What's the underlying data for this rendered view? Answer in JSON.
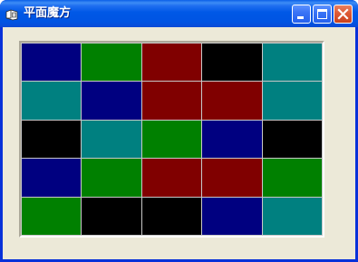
{
  "window": {
    "title": "平面魔方",
    "icon": "app-icon"
  },
  "titlebar_buttons": [
    {
      "name": "minimize-button",
      "icon": "minimize-icon"
    },
    {
      "name": "maximize-button",
      "icon": "maximize-icon"
    },
    {
      "name": "close-button",
      "icon": "close-icon"
    }
  ],
  "colors": {
    "blue": "#000080",
    "green": "#008000",
    "red": "#800000",
    "black": "#000000",
    "teal": "#008080"
  },
  "grid": {
    "rows": [
      [
        "blue",
        "green",
        "red",
        "black",
        "teal"
      ],
      [
        "teal",
        "blue",
        "red",
        "red",
        "teal"
      ],
      [
        "black",
        "teal",
        "green",
        "blue",
        "black"
      ],
      [
        "blue",
        "green",
        "red",
        "red",
        "green"
      ],
      [
        "green",
        "black",
        "black",
        "blue",
        "teal"
      ]
    ]
  }
}
